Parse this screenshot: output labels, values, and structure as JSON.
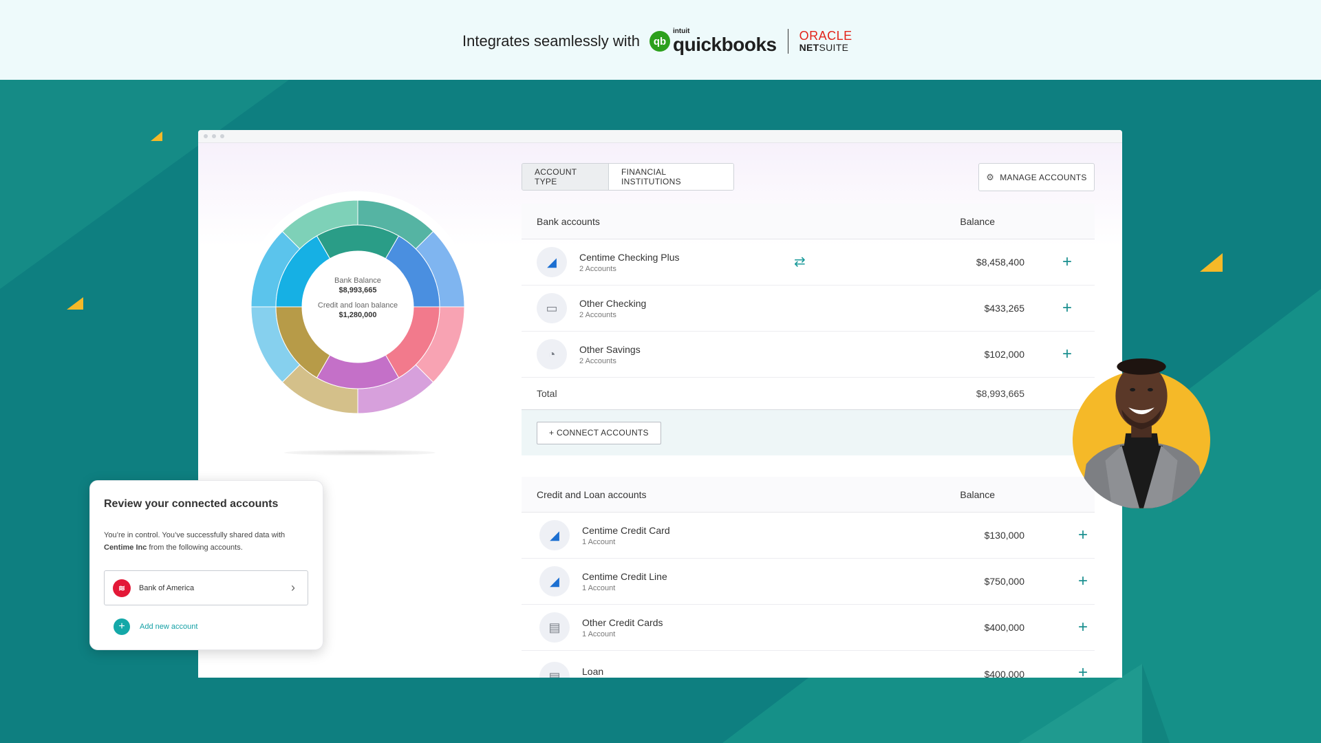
{
  "banner": {
    "text": "Integrates seamlessly with",
    "qb_intuit": "intuit",
    "qb_name": "quickbooks",
    "oracle_top": "ORACLE",
    "oracle_bottom_net": "NET",
    "oracle_bottom_suite": "SUITE"
  },
  "tabs": {
    "account_type": "ACCOUNT TYPE",
    "financial_institutions": "FINANCIAL INSTITUTIONS"
  },
  "manage_accounts": "MANAGE ACCOUNTS",
  "donut": {
    "bank_label": "Bank Balance",
    "bank_value": "$8,993,665",
    "credit_label": "Credit and loan balance",
    "credit_value": "$1,280,000",
    "colors_inner": [
      "#2a9d87",
      "#4a8fe0",
      "#f27a8c",
      "#c470c8",
      "#b79b48",
      "#16b0e4"
    ],
    "colors_outer": [
      "#55b4a3",
      "#7fb5f0",
      "#f8a3b3",
      "#d7a0dc",
      "#d4c08a",
      "#86d0ee",
      "#5bc4ec",
      "#7ed1b8"
    ]
  },
  "bank": {
    "header_name": "Bank accounts",
    "header_balance": "Balance",
    "rows": [
      {
        "name": "Centime Checking Plus",
        "sub": "2 Accounts",
        "balance": "$8,458,400",
        "icon": "centime-logo-icon"
      },
      {
        "name": "Other Checking",
        "sub": "2 Accounts",
        "balance": "$433,265",
        "icon": "check-icon"
      },
      {
        "name": "Other Savings",
        "sub": "2 Accounts",
        "balance": "$102,000",
        "icon": "piggy-bank-icon"
      }
    ],
    "total_label": "Total",
    "total_value": "$8,993,665",
    "connect_label": "+ CONNECT ACCOUNTS"
  },
  "credit": {
    "header_name": "Credit and Loan accounts",
    "header_balance": "Balance",
    "rows": [
      {
        "name": "Centime Credit Card",
        "sub": "1 Account",
        "balance": "$130,000",
        "icon": "centime-logo-icon"
      },
      {
        "name": "Centime Credit Line",
        "sub": "1 Account",
        "balance": "$750,000",
        "icon": "centime-logo-icon"
      },
      {
        "name": "Other Credit Cards",
        "sub": "1 Account",
        "balance": "$400,000",
        "icon": "credit-card-icon"
      },
      {
        "name": "Loan",
        "sub": "",
        "balance": "$400,000",
        "icon": "loan-icon"
      }
    ]
  },
  "review": {
    "title": "Review your connected accounts",
    "desc_1": "You’re in control. You’ve successfully shared data with",
    "desc_company": "Centime Inc",
    "desc_2": "from the following accounts.",
    "bank_name": "Bank of America",
    "add_label": "Add new account"
  },
  "colors": {
    "background": "#0e7f80",
    "accent_teal": "#14a8a8",
    "accent_yellow": "#f5b928",
    "centime_blue": "#1c6fd1"
  }
}
